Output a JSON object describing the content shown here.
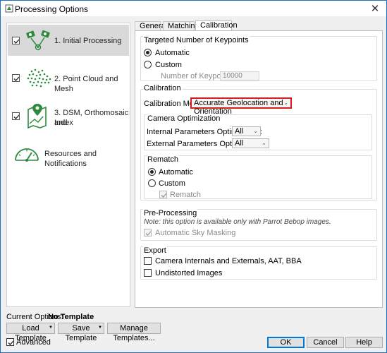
{
  "window": {
    "title": "Processing Options",
    "close_glyph": "✕"
  },
  "nav": {
    "items": [
      {
        "label_line1": "1. Initial Processing",
        "label_line2": "",
        "checked": true,
        "icon": "initial-processing-icon"
      },
      {
        "label_line1": "2. Point Cloud and Mesh",
        "label_line2": "",
        "checked": true,
        "icon": "point-cloud-icon"
      },
      {
        "label_line1": "3. DSM, Orthomosaic and",
        "label_line2": "Index",
        "checked": true,
        "icon": "map-pin-icon"
      },
      {
        "label_line1": "Resources and Notifications",
        "label_line2": "",
        "checked": false,
        "icon": "gauge-icon"
      }
    ]
  },
  "tabs": [
    "General",
    "Matching",
    "Calibration"
  ],
  "active_tab": "Calibration",
  "keypoints": {
    "title": "Targeted Number of Keypoints",
    "automatic_label": "Automatic",
    "custom_label": "Custom",
    "number_label": "Number of Keypoints:",
    "number_value": "10000"
  },
  "calibration": {
    "title": "Calibration",
    "method_label": "Calibration Method",
    "method_value": "Accurate Geolocation and Orientation",
    "camera_opt_title": "Camera Optimization",
    "internal_label": "Internal Parameters Optimization:",
    "internal_value": "All",
    "external_label": "External Parameters Optimization:",
    "external_value": "All",
    "rematch_title": "Rematch",
    "rematch_automatic": "Automatic",
    "rematch_custom": "Custom",
    "rematch_checkbox": "Rematch"
  },
  "preprocessing": {
    "title": "Pre-Processing",
    "note": "Note: this option is available only with Parrot Bebop images.",
    "sky_masking": "Automatic Sky Masking"
  },
  "export": {
    "title": "Export",
    "camera_internals": "Camera Internals and Externals, AAT, BBA",
    "undistorted": "Undistorted Images"
  },
  "bottom": {
    "current_options_label": "Current Options:",
    "current_options_value": "No Template",
    "load_template": "Load Template",
    "save_template": "Save Template",
    "manage_templates": "Manage Templates...",
    "advanced": "Advanced",
    "ok": "OK",
    "cancel": "Cancel",
    "help": "Help"
  },
  "colors": {
    "accent_green": "#2e8b3e",
    "highlight_red": "#d91c1c",
    "primary_blue": "#0078d7"
  }
}
